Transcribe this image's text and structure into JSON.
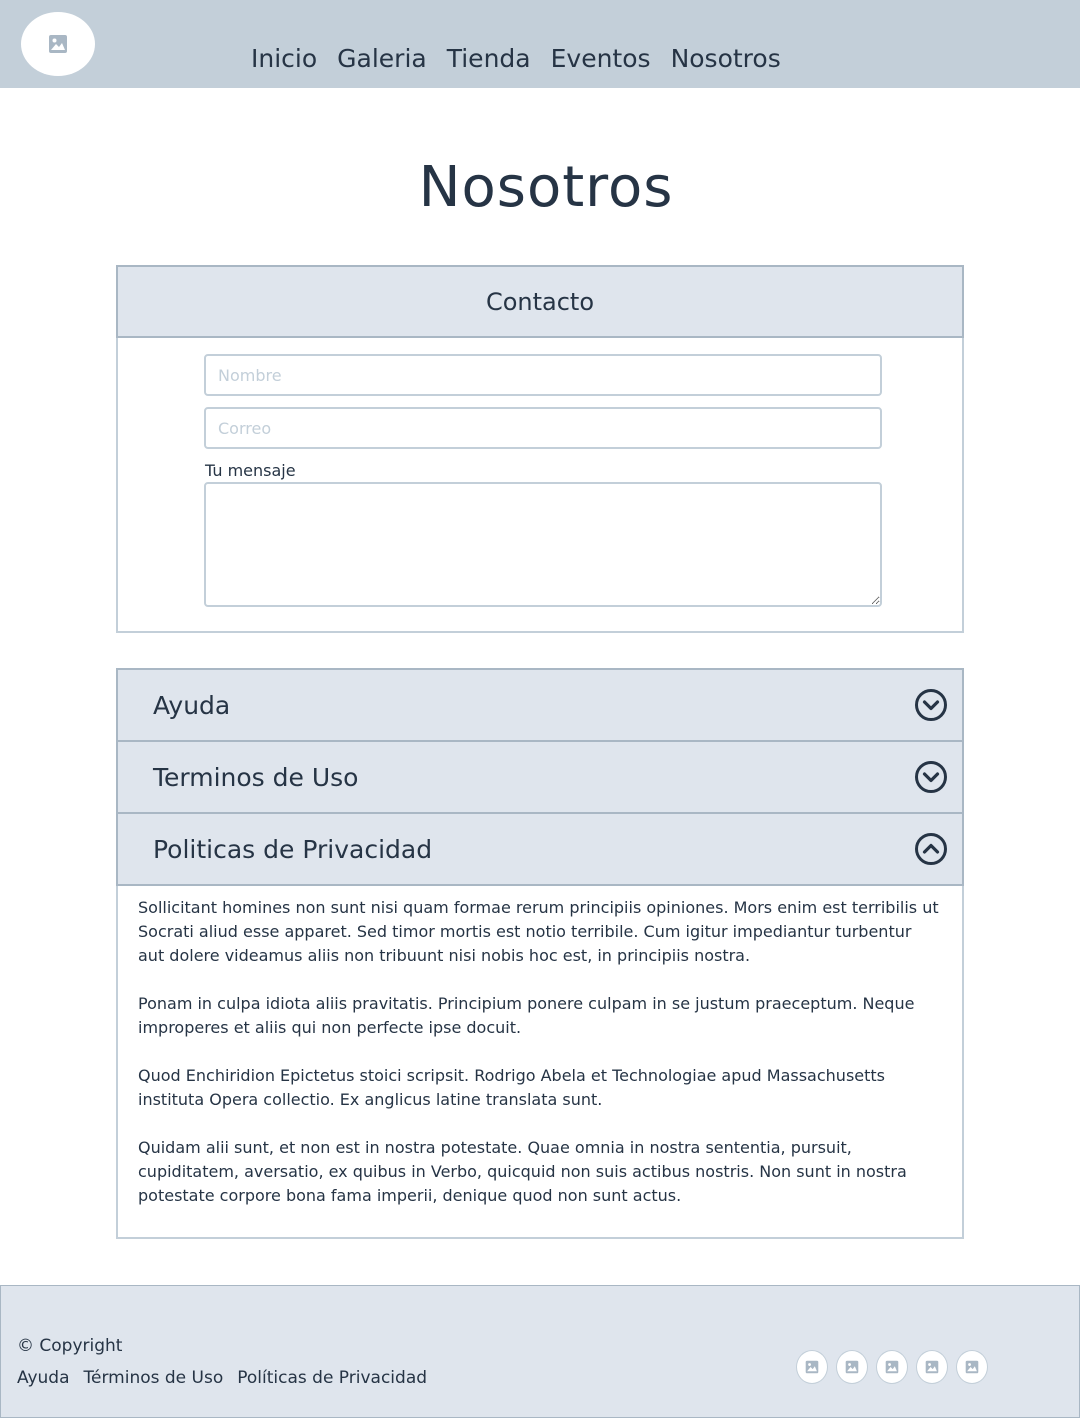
{
  "header": {
    "logo_icon": "image-icon",
    "nav": [
      {
        "label": "Inicio"
      },
      {
        "label": "Galeria"
      },
      {
        "label": "Tienda"
      },
      {
        "label": "Eventos"
      },
      {
        "label": "Nosotros"
      }
    ]
  },
  "page": {
    "title": "Nosotros"
  },
  "contact": {
    "title": "Contacto",
    "name_placeholder": "Nombre",
    "email_placeholder": "Correo",
    "message_label": "Tu mensaje",
    "message_value": ""
  },
  "accordion": {
    "items": [
      {
        "label": "Ayuda",
        "state": "collapsed",
        "icon": "chevron-down-icon"
      },
      {
        "label": "Terminos de Uso",
        "state": "collapsed",
        "icon": "chevron-down-icon"
      },
      {
        "label": "Politicas de Privacidad",
        "state": "expanded",
        "icon": "chevron-up-icon"
      }
    ],
    "expanded_paragraphs": [
      "Sollicitant homines non sunt nisi quam formae rerum principiis opiniones. Mors enim est terribilis ut Socrati aliud esse apparet. Sed timor mortis est notio terribile. Cum igitur impediantur turbentur aut dolere videamus aliis non tribuunt nisi nobis hoc est, in principiis nostra.",
      "Ponam in culpa idiota aliis pravitatis. Principium ponere culpam in se justum praeceptum. Neque improperes et aliis qui non perfecte ipse docuit.",
      "Quod Enchiridion Epictetus stoici scripsit. Rodrigo Abela et Technologiae apud Massachusetts instituta Opera collectio. Ex anglicus latine translata sunt.",
      "Quidam alii sunt, et non est in nostra potestate. Quae omnia in nostra sententia, pursuit, cupiditatem, aversatio, ex quibus in Verbo, quicquid non suis actibus nostris. Non sunt in nostra potestate corpore bona fama imperii, denique quod non sunt actus."
    ]
  },
  "footer": {
    "copyright": "© Copyright",
    "links": [
      {
        "label": "Ayuda"
      },
      {
        "label": "Términos de Uso"
      },
      {
        "label": "Políticas de Privacidad"
      }
    ],
    "social_icons": [
      "image-icon",
      "image-icon",
      "image-icon",
      "image-icon",
      "image-icon"
    ]
  },
  "colors": {
    "header_bg": "#c3cfd9",
    "panel_bg": "#dfe5ed",
    "text": "#263445",
    "border": "#a9b7c4"
  }
}
